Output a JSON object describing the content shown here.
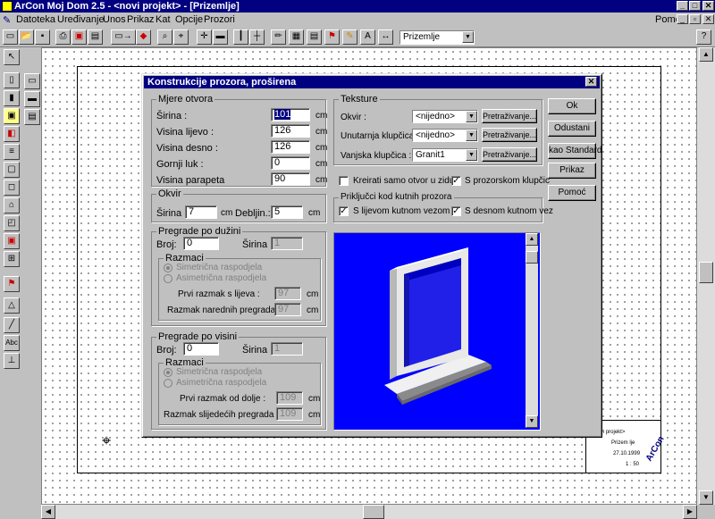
{
  "app": {
    "title": "ArCon Moj Dom  2.5 - <novi projekt> - [Prizemlje]"
  },
  "menu": {
    "items": [
      "Datoteka",
      "Uređivanje",
      "Unos",
      "Prikaz",
      "Kat",
      "Opcije",
      "Prozori"
    ],
    "help": "Pomoć"
  },
  "toolbar": {
    "floor_select": "Prizemlje"
  },
  "dialog": {
    "title": "Konstrukcije prozora, proširena",
    "mjere": {
      "label": "Mjere otvora",
      "sirina": {
        "label": "Širina :",
        "value": "101",
        "unit": "cm"
      },
      "visina_lijevo": {
        "label": "Visina lijevo :",
        "value": "126",
        "unit": "cm"
      },
      "visina_desno": {
        "label": "Visina desno :",
        "value": "126",
        "unit": "cm"
      },
      "gornji_luk": {
        "label": "Gornji luk :",
        "value": "0",
        "unit": "cm"
      },
      "visina_parapeta": {
        "label": "Visina parapeta",
        "value": "90",
        "unit": "cm"
      }
    },
    "okvir": {
      "label": "Okvir",
      "sirina_label": "Širina :",
      "sirina_value": "7",
      "debljina_label": "Debljin.:",
      "debljina_value": "5",
      "unit": "cm"
    },
    "pregrade_duzini": {
      "label": "Pregrade po dužini",
      "broj_label": "Broj:",
      "broj_value": "0",
      "sirina_label": "Širina :",
      "sirina_value": "1",
      "razmaci_label": "Razmaci",
      "radio1": "Simetrična raspodjela",
      "radio2": "Asimetrična raspodjela",
      "prvi_label": "Prvi razmak s lijeva :",
      "prvi_value": "97",
      "naredni_label": "Razmak narednih pregrada :",
      "naredni_value": "97",
      "unit": "cm"
    },
    "pregrade_visini": {
      "label": "Pregrade po visini",
      "broj_label": "Broj:",
      "broj_value": "0",
      "sirina_label": "Širina :",
      "sirina_value": "1",
      "razmaci_label": "Razmaci",
      "radio1": "Simetrična raspodjela",
      "radio2": "Asimetrična raspodjela",
      "prvi_label": "Prvi razmak od dolje :",
      "prvi_value": "109",
      "slijedeci_label": "Razmak slijedećih pregrada :",
      "slijedeci_value": "109",
      "unit": "cm"
    },
    "teksture": {
      "label": "Teksture",
      "okvir_label": "Okvir :",
      "okvir_value": "<nijedno>",
      "unutarnja_label": "Unutarnja klupčica :",
      "unutarnja_value": "<nijedno>",
      "vanjska_label": "Vanjska klupčica :",
      "vanjska_value": "Granit1",
      "browse": "Pretraživanje..."
    },
    "kreirati_otvor": "Kreirati samo otvor u zidu",
    "s_prozorskom": "S prozorskom klupčic",
    "prikljucci": {
      "label": "Priključci kod kutnih prozora",
      "lijevi": "S lijevom kutnom vezom",
      "desni": "S desnom kutnom vez"
    },
    "buttons": {
      "ok": "Ok",
      "cancel": "Odustani",
      "standard": "kao Standard",
      "show": "Prikaz",
      "help": "Pomoć"
    }
  },
  "titleblock": {
    "line1": "< novi projekt>",
    "line2": "Prizem lje",
    "line3": "27.10.1999",
    "line4": "1 : 50",
    "logo": "ArCon"
  }
}
